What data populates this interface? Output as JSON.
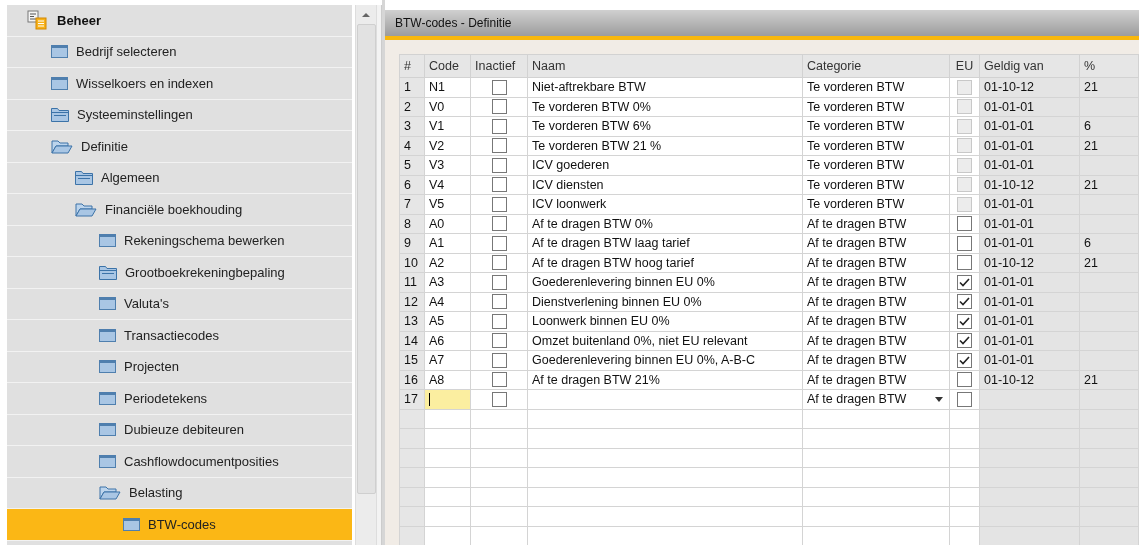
{
  "sidebar": {
    "items": [
      {
        "label": "Beheer",
        "kind": "root",
        "selected": false,
        "children": [
          {
            "label": "Bedrijf selecteren",
            "kind": "window",
            "selected": false
          },
          {
            "label": "Wisselkoers en indexen",
            "kind": "window",
            "selected": false
          },
          {
            "label": "Systeeminstellingen",
            "kind": "folder",
            "expanded": false,
            "selected": false
          },
          {
            "label": "Definitie",
            "kind": "folder",
            "expanded": true,
            "selected": false,
            "children": [
              {
                "label": "Algemeen",
                "kind": "folder",
                "expanded": false,
                "selected": false
              },
              {
                "label": "Financiële boekhouding",
                "kind": "folder",
                "expanded": true,
                "selected": false,
                "children": [
                  {
                    "label": "Rekeningschema bewerken",
                    "kind": "window",
                    "selected": false
                  },
                  {
                    "label": "Grootboekrekeningbepaling",
                    "kind": "folder",
                    "expanded": false,
                    "selected": false
                  },
                  {
                    "label": "Valuta's",
                    "kind": "window",
                    "selected": false
                  },
                  {
                    "label": "Transactiecodes",
                    "kind": "window",
                    "selected": false
                  },
                  {
                    "label": "Projecten",
                    "kind": "window",
                    "selected": false
                  },
                  {
                    "label": "Periodetekens",
                    "kind": "window",
                    "selected": false
                  },
                  {
                    "label": "Dubieuze debiteuren",
                    "kind": "window",
                    "selected": false
                  },
                  {
                    "label": "Cashflowdocumentposities",
                    "kind": "window",
                    "selected": false
                  },
                  {
                    "label": "Belasting",
                    "kind": "folder",
                    "expanded": true,
                    "selected": false,
                    "children": [
                      {
                        "label": "BTW-codes",
                        "kind": "window",
                        "selected": true
                      }
                    ]
                  }
                ]
              }
            ]
          }
        ]
      }
    ]
  },
  "window": {
    "title": "BTW-codes - Definitie"
  },
  "table": {
    "columns": [
      "#",
      "Code",
      "Inactief",
      "Naam",
      "Categorie",
      "EU",
      "Geldig van",
      "%"
    ],
    "rows": [
      {
        "n": "1",
        "code": "N1",
        "inactive": false,
        "name": "Niet-aftrekbare BTW",
        "category": "Te vorderen BTW",
        "eu": false,
        "eu_disabled": true,
        "valid_from": "01-10-12",
        "percent": "21"
      },
      {
        "n": "2",
        "code": "V0",
        "inactive": false,
        "name": "Te vorderen BTW 0%",
        "category": "Te vorderen BTW",
        "eu": false,
        "eu_disabled": true,
        "valid_from": "01-01-01"
      },
      {
        "n": "3",
        "code": "V1",
        "inactive": false,
        "name": "Te vorderen BTW 6%",
        "category": "Te vorderen BTW",
        "eu": false,
        "eu_disabled": true,
        "valid_from": "01-01-01",
        "percent": "6"
      },
      {
        "n": "4",
        "code": "V2",
        "inactive": false,
        "name": "Te vorderen BTW 21 %",
        "category": "Te vorderen BTW",
        "eu": false,
        "eu_disabled": true,
        "valid_from": "01-01-01",
        "percent": "21"
      },
      {
        "n": "5",
        "code": "V3",
        "inactive": false,
        "name": "ICV goederen",
        "category": "Te vorderen BTW",
        "eu": false,
        "eu_disabled": true,
        "valid_from": "01-01-01"
      },
      {
        "n": "6",
        "code": "V4",
        "inactive": false,
        "name": "ICV diensten",
        "category": "Te vorderen BTW",
        "eu": false,
        "eu_disabled": true,
        "valid_from": "01-10-12",
        "percent": "21"
      },
      {
        "n": "7",
        "code": "V5",
        "inactive": false,
        "name": "ICV loonwerk",
        "category": "Te vorderen BTW",
        "eu": false,
        "eu_disabled": true,
        "valid_from": "01-01-01"
      },
      {
        "n": "8",
        "code": "A0",
        "inactive": false,
        "name": "Af te dragen BTW 0%",
        "category": "Af te dragen BTW",
        "eu": false,
        "eu_disabled": false,
        "valid_from": "01-01-01"
      },
      {
        "n": "9",
        "code": "A1",
        "inactive": false,
        "name": "Af te dragen BTW laag tarief",
        "category": "Af te dragen BTW",
        "eu": false,
        "eu_disabled": false,
        "valid_from": "01-01-01",
        "percent": "6"
      },
      {
        "n": "10",
        "code": "A2",
        "inactive": false,
        "name": "Af te dragen BTW hoog tarief",
        "category": "Af te dragen BTW",
        "eu": false,
        "eu_disabled": false,
        "valid_from": "01-10-12",
        "percent": "21"
      },
      {
        "n": "11",
        "code": "A3",
        "inactive": false,
        "name": "Goederenlevering binnen EU 0%",
        "category": "Af te dragen BTW",
        "eu": true,
        "eu_disabled": false,
        "valid_from": "01-01-01"
      },
      {
        "n": "12",
        "code": "A4",
        "inactive": false,
        "name": "Dienstverlening binnen EU 0%",
        "category": "Af te dragen BTW",
        "eu": true,
        "eu_disabled": false,
        "valid_from": "01-01-01"
      },
      {
        "n": "13",
        "code": "A5",
        "inactive": false,
        "name": "Loonwerk binnen EU 0%",
        "category": "Af te dragen BTW",
        "eu": true,
        "eu_disabled": false,
        "valid_from": "01-01-01"
      },
      {
        "n": "14",
        "code": "A6",
        "inactive": false,
        "name": "Omzet buitenland 0%, niet EU relevant",
        "category": "Af te dragen BTW",
        "eu": true,
        "eu_disabled": false,
        "valid_from": "01-01-01"
      },
      {
        "n": "15",
        "code": "A7",
        "inactive": false,
        "name": "Goederenlevering binnen EU 0%, A-B-C",
        "category": "Af te dragen BTW",
        "eu": true,
        "eu_disabled": false,
        "valid_from": "01-01-01"
      },
      {
        "n": "16",
        "code": "A8",
        "inactive": false,
        "name": "Af te dragen BTW 21%",
        "category": "Af te dragen BTW",
        "eu": false,
        "eu_disabled": false,
        "valid_from": "01-10-12",
        "percent": "21"
      },
      {
        "n": "17",
        "editing": true,
        "inactive": false,
        "category": "Af te dragen BTW",
        "dropdown": true,
        "eu": false,
        "eu_disabled": false
      }
    ]
  }
}
